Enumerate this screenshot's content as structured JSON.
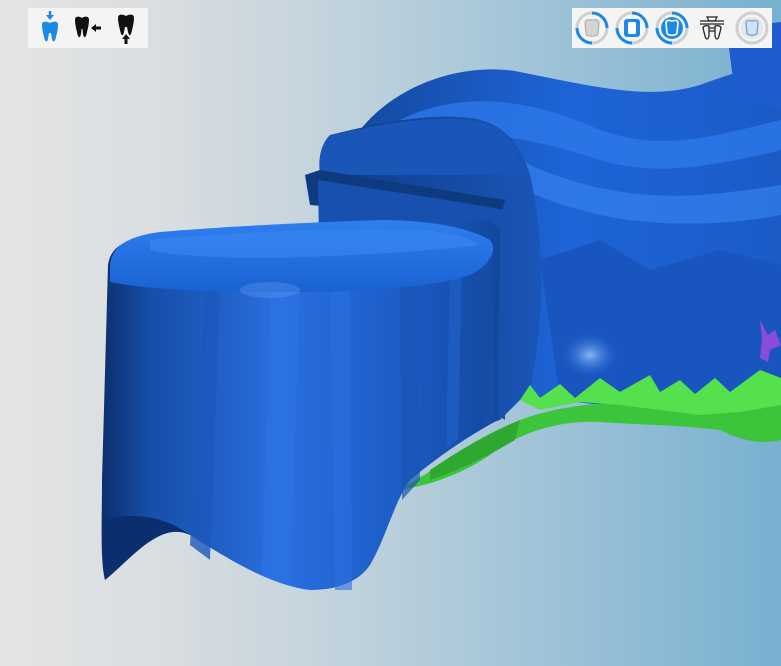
{
  "app": {
    "view": "3d-tooth-model-viewport"
  },
  "colors": {
    "model_blue": "#1a66d6",
    "model_dark": "#0e3f8c",
    "gingiva_green": "#4fd84a",
    "accent_purple": "#8a4cd8",
    "toolbar_bg": "#f4f4f4",
    "active_icon": "#1e88e5"
  },
  "toolbar_left": {
    "items": [
      {
        "icon": "tooth-insertion-direction-icon",
        "active": true
      },
      {
        "icon": "tooth-move-left-icon",
        "active": false
      },
      {
        "icon": "tooth-move-up-icon",
        "active": false
      }
    ]
  },
  "toolbar_right": {
    "items": [
      {
        "icon": "tooth-crown-rotate-icon",
        "active": true
      },
      {
        "icon": "tooth-bridge-icon",
        "active": true
      },
      {
        "icon": "tooth-shell-icon",
        "active": true
      },
      {
        "icon": "tooth-attachment-icon",
        "active": false
      },
      {
        "icon": "tooth-crown-outline-icon",
        "active": false
      }
    ]
  }
}
